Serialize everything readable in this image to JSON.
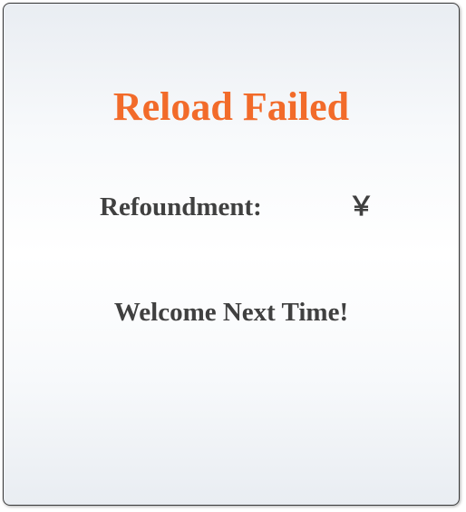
{
  "dialog": {
    "title": "Reload Failed",
    "refund_label": "Refoundment:",
    "refund_amount": "￥",
    "message": "Welcome Next Time!",
    "colors": {
      "title": "#f26b2a",
      "text": "#404040",
      "border": "#3a3a3a"
    }
  }
}
